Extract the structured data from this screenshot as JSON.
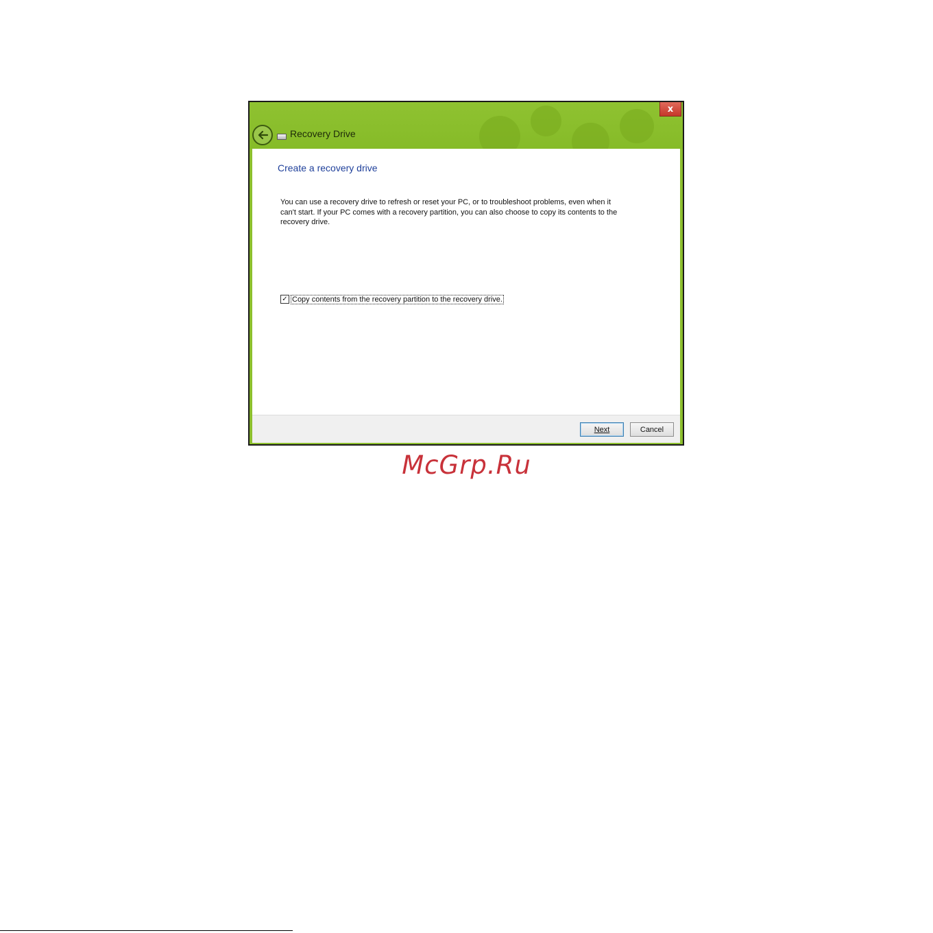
{
  "window": {
    "title": "Recovery Drive",
    "close_label": "x",
    "accent_color": "#8cbf2d"
  },
  "icons": {
    "back": "back-arrow-icon",
    "drive": "drive-icon",
    "close": "close-icon",
    "check": "checkmark-icon"
  },
  "content": {
    "heading": "Create a recovery drive",
    "description": "You can use a recovery drive to refresh or reset your PC, or to troubleshoot problems, even when it can't start. If your PC comes with a recovery partition, you can also choose to copy its contents to the recovery drive.",
    "checkbox": {
      "label": "Copy contents from the recovery partition to the recovery drive.",
      "checked": true,
      "mark": "✓"
    }
  },
  "footer": {
    "next_label": "Next",
    "cancel_label": "Cancel"
  },
  "page": {
    "watermark": "McGrp.Ru"
  }
}
